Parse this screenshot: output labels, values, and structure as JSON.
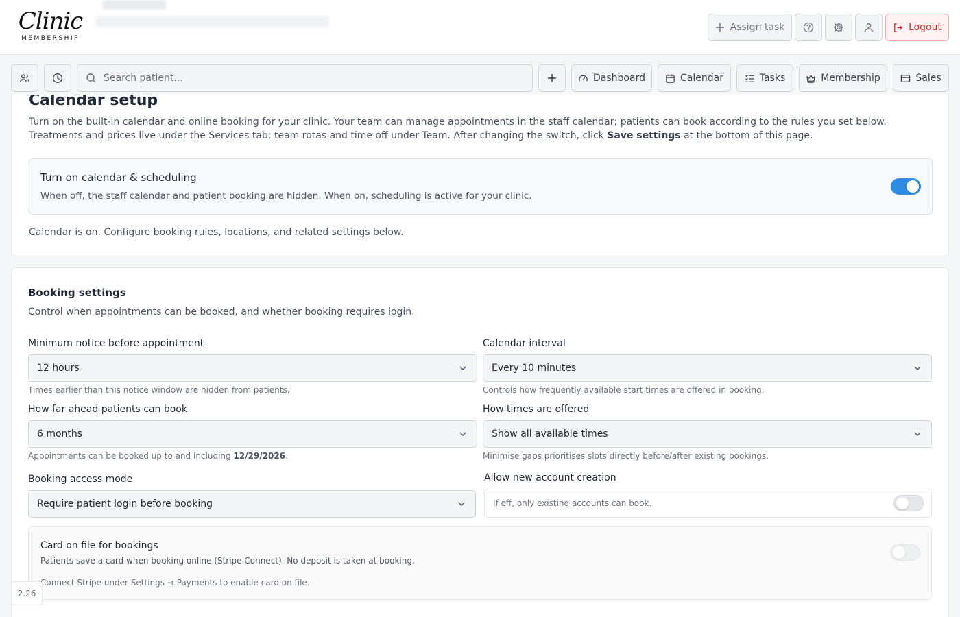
{
  "brand": {
    "script": "Clinic",
    "sub": "MEMBERSHIP"
  },
  "header": {
    "assign_task": "Assign task",
    "logout": "Logout"
  },
  "toolbar": {
    "search_placeholder": "Search patient...",
    "dashboard": "Dashboard",
    "calendar": "Calendar",
    "tasks": "Tasks",
    "membership": "Membership",
    "sales": "Sales"
  },
  "calendar_setup": {
    "title": "Calendar setup",
    "desc_part1": "Turn on the built-in calendar and online booking for your clinic. Your team can manage appointments in the staff calendar; patients can book according to the rules you set below. Treatments and prices live under the Services tab; team rotas and time off under Team. After changing the switch, click ",
    "desc_bold": "Save settings",
    "desc_part2": " at the bottom of this page.",
    "toggle_title": "Turn on calendar & scheduling",
    "toggle_desc": "When off, the staff calendar and patient booking are hidden. When on, scheduling is active for your clinic.",
    "toggle_on": true,
    "status": "Calendar is on. Configure booking rules, locations, and related settings below."
  },
  "booking": {
    "title": "Booking settings",
    "desc": "Control when appointments can be booked, and whether booking requires login.",
    "min_notice_label": "Minimum notice before appointment",
    "min_notice_value": "12 hours",
    "min_notice_help": "Times earlier than this notice window are hidden from patients.",
    "interval_label": "Calendar interval",
    "interval_value": "Every 10 minutes",
    "interval_help": "Controls how frequently available start times are offered in booking.",
    "ahead_label": "How far ahead patients can book",
    "ahead_value": "6 months",
    "ahead_help_pre": "Appointments can be booked up to and including ",
    "ahead_help_date": "12/29/2026",
    "ahead_help_post": ".",
    "offered_label": "How times are offered",
    "offered_value": "Show all available times",
    "offered_help": "Minimise gaps prioritises slots directly before/after existing bookings.",
    "access_label": "Booking access mode",
    "access_value": "Require patient login before booking",
    "new_account_label": "Allow new account creation",
    "new_account_help": "If off, only existing accounts can book.",
    "new_account_on": false,
    "card_title": "Card on file for bookings",
    "card_desc": "Patients save a card when booking online (Stripe Connect). No deposit is taken at booking.",
    "card_note": "Connect Stripe under Settings → Payments to enable card on file.",
    "card_on": false
  },
  "version": "2.26",
  "colors": {
    "accent": "#2d8ce6",
    "danger": "#dc2626"
  },
  "icons": {
    "assign": "plus-icon",
    "help": "help-circle-icon",
    "settings": "gear-icon",
    "profile": "user-icon",
    "logout": "logout-icon",
    "patients": "users-icon",
    "history": "clock-icon",
    "search": "search-icon",
    "add": "plus-icon",
    "dashboard": "gauge-icon",
    "calendar": "calendar-icon",
    "tasks": "checklist-icon",
    "membership": "crown-icon",
    "sales": "credit-card-icon"
  }
}
